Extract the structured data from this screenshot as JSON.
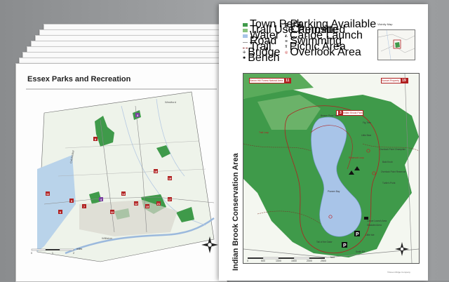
{
  "left_map": {
    "title": "Essex Parks and Recreation",
    "towns": [
      "Westford",
      "Colchester",
      "Williston"
    ],
    "scale_label": "miles",
    "scale_ticks": [
      "0",
      "1",
      "2"
    ],
    "markers": [
      "3",
      "8",
      "18",
      "19",
      "11",
      "9",
      "7",
      "4",
      "14",
      "12",
      "15",
      "21",
      "17",
      "6",
      "22"
    ]
  },
  "right_map": {
    "title": "Indian Brook Conservation Area",
    "legend": [
      {
        "label": "Town Park",
        "color": "#3f9a4a"
      },
      {
        "label": "Trail Use Permitted",
        "color": "#89c37f"
      },
      {
        "label": "Water",
        "color": "#a8c4e8"
      },
      {
        "label": "Road",
        "color": "#999999"
      },
      {
        "label": "Trail",
        "color": "#8b2020"
      },
      {
        "label": "Bridge",
        "color": "#333333"
      },
      {
        "label": "Bench",
        "color": "#333333"
      },
      {
        "label": "Parking Available",
        "color": "#222222"
      },
      {
        "label": "Campsite",
        "color": "#222222"
      },
      {
        "label": "Canoe Launch",
        "color": "#222222"
      },
      {
        "label": "Swimming",
        "color": "#222222"
      },
      {
        "label": "Picnic Area",
        "color": "#222222"
      },
      {
        "label": "Overlook Area",
        "color": "#c02020"
      }
    ],
    "vicinity_label": "Vicinity Map",
    "badges": [
      {
        "text": "Saxon Hill Forest Natural Area",
        "num": "11"
      },
      {
        "text": "Sunset Property",
        "num": "19"
      },
      {
        "text": "Indian Brook Park",
        "num": "3"
      }
    ],
    "labels": [
      "Beaver Pond Trail",
      "Fig Tree",
      "Little Bear",
      "Overlook Point Champlain",
      "Bald Knob",
      "Overlook Point Reservoir",
      "Turtle's Point",
      "Pioneer Bay",
      "Canoe Launch Area",
      "Glaciated Area",
      "Little Isle",
      "Tail of the Gator",
      "Smith Rd"
    ],
    "red_labels": [
      "Trail Loop",
      "Reservoir Loop"
    ],
    "scale_ticks": [
      "0",
      "500",
      "1000",
      "1500",
      "2000",
      "2500"
    ],
    "scale_unit": "feet",
    "footer": "©Green Ridge Company"
  }
}
